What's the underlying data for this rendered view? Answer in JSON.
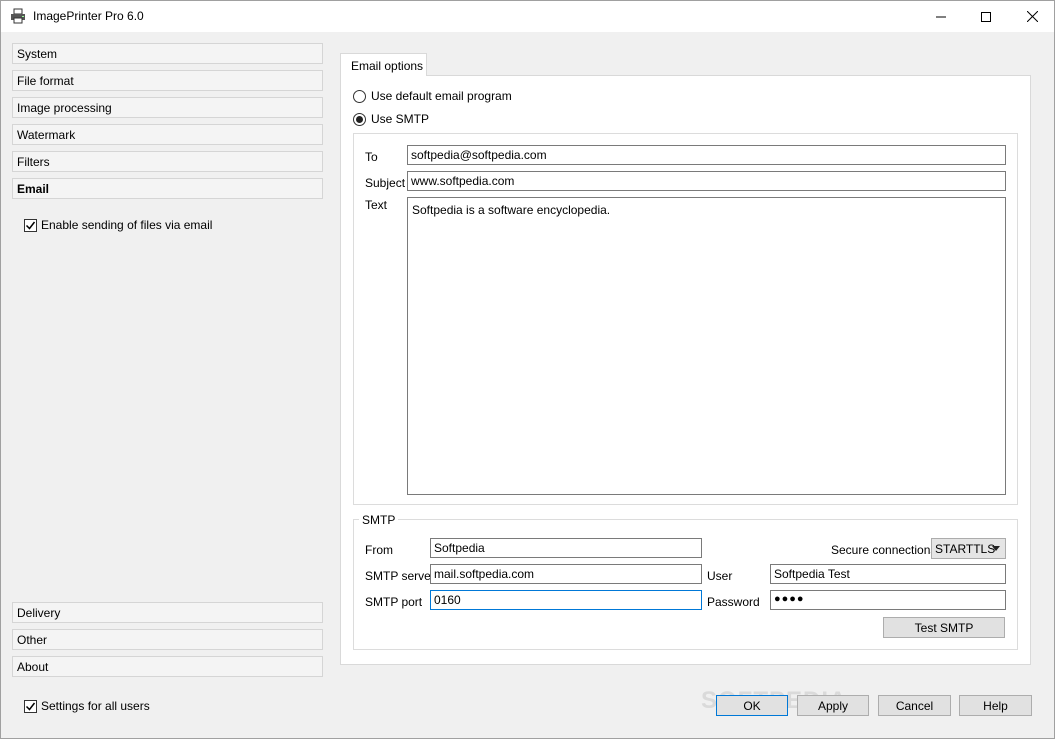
{
  "window": {
    "title": "ImagePrinter Pro 6.0",
    "controls": {
      "minimize": "─",
      "maximize": "☐",
      "close": "✕"
    }
  },
  "sidebar": {
    "items_top": [
      {
        "label": "System"
      },
      {
        "label": "File format"
      },
      {
        "label": "Image processing"
      },
      {
        "label": "Watermark"
      },
      {
        "label": "Filters"
      },
      {
        "label": "Email",
        "active": true
      }
    ],
    "enable_email_label": "Enable sending of files via email",
    "enable_email_checked": true,
    "items_bottom": [
      {
        "label": "Delivery"
      },
      {
        "label": "Other"
      },
      {
        "label": "About"
      }
    ],
    "all_users_label": "Settings for all users",
    "all_users_checked": true
  },
  "email_tab": {
    "tab_label": "Email options",
    "radio_default": "Use default email program",
    "radio_smtp": "Use SMTP",
    "selected": "smtp",
    "to_label": "To",
    "to_value": "softpedia@softpedia.com",
    "subject_label": "Subject",
    "subject_value": "www.softpedia.com",
    "text_label": "Text",
    "text_value": "Softpedia is a software encyclopedia."
  },
  "smtp": {
    "legend": "SMTP",
    "from_label": "From",
    "from_value": "Softpedia",
    "server_label": "SMTP server",
    "server_value": "mail.softpedia.com",
    "port_label": "SMTP port",
    "port_value": "0160",
    "secure_label": "Secure connections",
    "secure_value": "STARTTLS",
    "user_label": "User",
    "user_value": "Softpedia Test",
    "password_label": "Password",
    "password_value": "●●●●",
    "test_button": "Test SMTP"
  },
  "footer": {
    "ok": "OK",
    "apply": "Apply",
    "cancel": "Cancel",
    "help": "Help"
  },
  "watermark_text": "SOFTPEDIA"
}
